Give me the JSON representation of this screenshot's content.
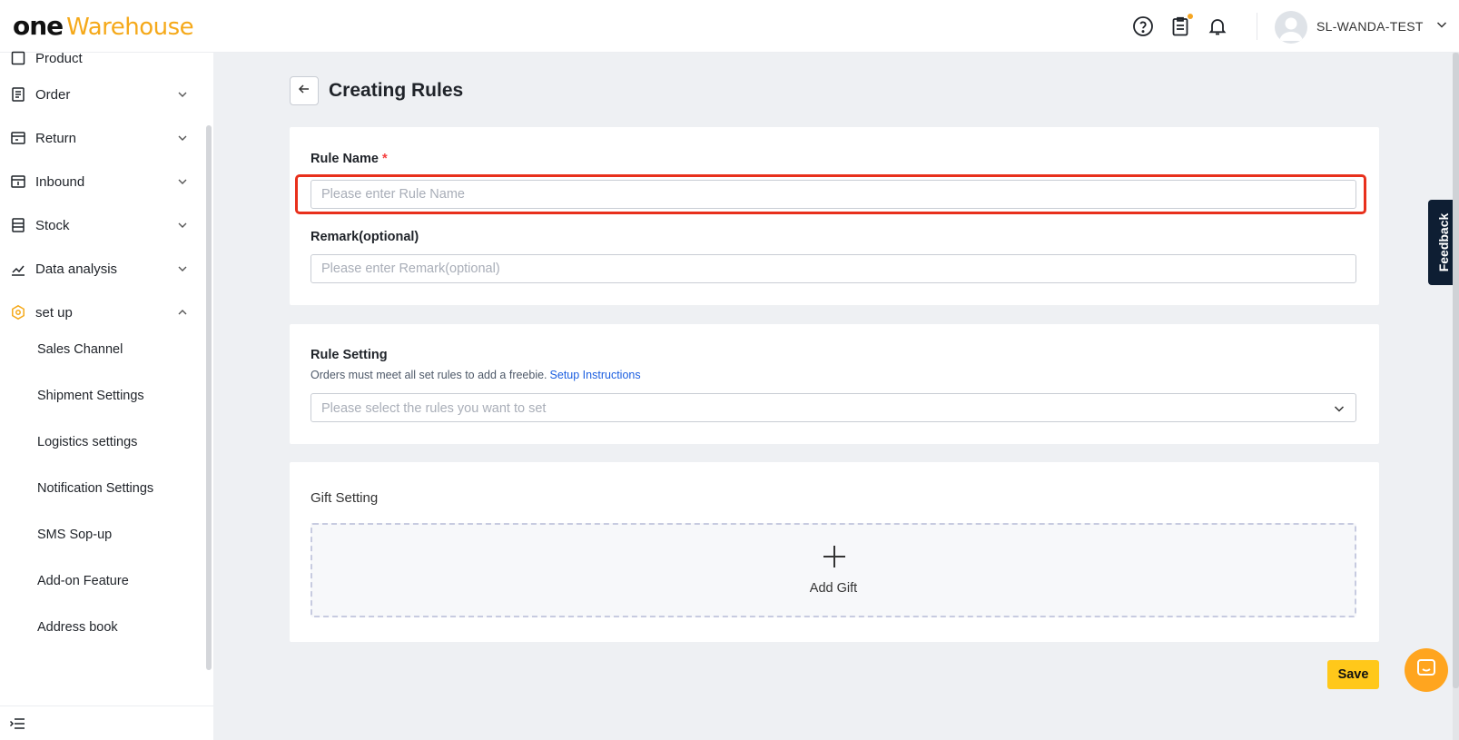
{
  "brand": {
    "part1": "one",
    "part2": "Warehouse",
    "accent": "#f5a91a"
  },
  "header": {
    "icons": [
      "help-circle-icon",
      "clipboard-icon",
      "bell-icon"
    ],
    "user_name": "SL-WANDA-TEST"
  },
  "sidebar": {
    "partial_item": "Product",
    "items": [
      {
        "label": "Order",
        "icon": "order-icon",
        "expanded": false
      },
      {
        "label": "Return",
        "icon": "return-icon",
        "expanded": false
      },
      {
        "label": "Inbound",
        "icon": "inbound-icon",
        "expanded": false
      },
      {
        "label": "Stock",
        "icon": "stock-icon",
        "expanded": false
      },
      {
        "label": "Data analysis",
        "icon": "chart-icon",
        "expanded": false
      },
      {
        "label": "set up",
        "icon": "setup-icon",
        "expanded": true
      }
    ],
    "sub_items": [
      "Sales Channel",
      "Shipment Settings",
      "Logistics settings",
      "Notification Settings",
      "SMS Sop-up",
      "Add-on Feature",
      "Address book"
    ]
  },
  "page": {
    "title": "Creating Rules",
    "rule_name": {
      "label": "Rule Name",
      "required_mark": "*",
      "placeholder": "Please enter Rule Name",
      "value": ""
    },
    "remark": {
      "label": "Remark(optional)",
      "placeholder": "Please enter Remark(optional)",
      "value": ""
    },
    "rule_setting": {
      "label": "Rule Setting",
      "description": "Orders must meet all set rules to add a freebie.",
      "link": "Setup Instructions",
      "placeholder": "Please select the rules you want to set"
    },
    "gift_setting": {
      "label": "Gift Setting",
      "add_label": "Add Gift"
    },
    "save_label": "Save",
    "feedback_label": "Feedback"
  },
  "colors": {
    "save_button": "#ffc81a",
    "highlight": "#e8301c",
    "link": "#1b5ee0",
    "feedback_bg": "#0e1e33",
    "chat_button": "#ffa51f"
  }
}
